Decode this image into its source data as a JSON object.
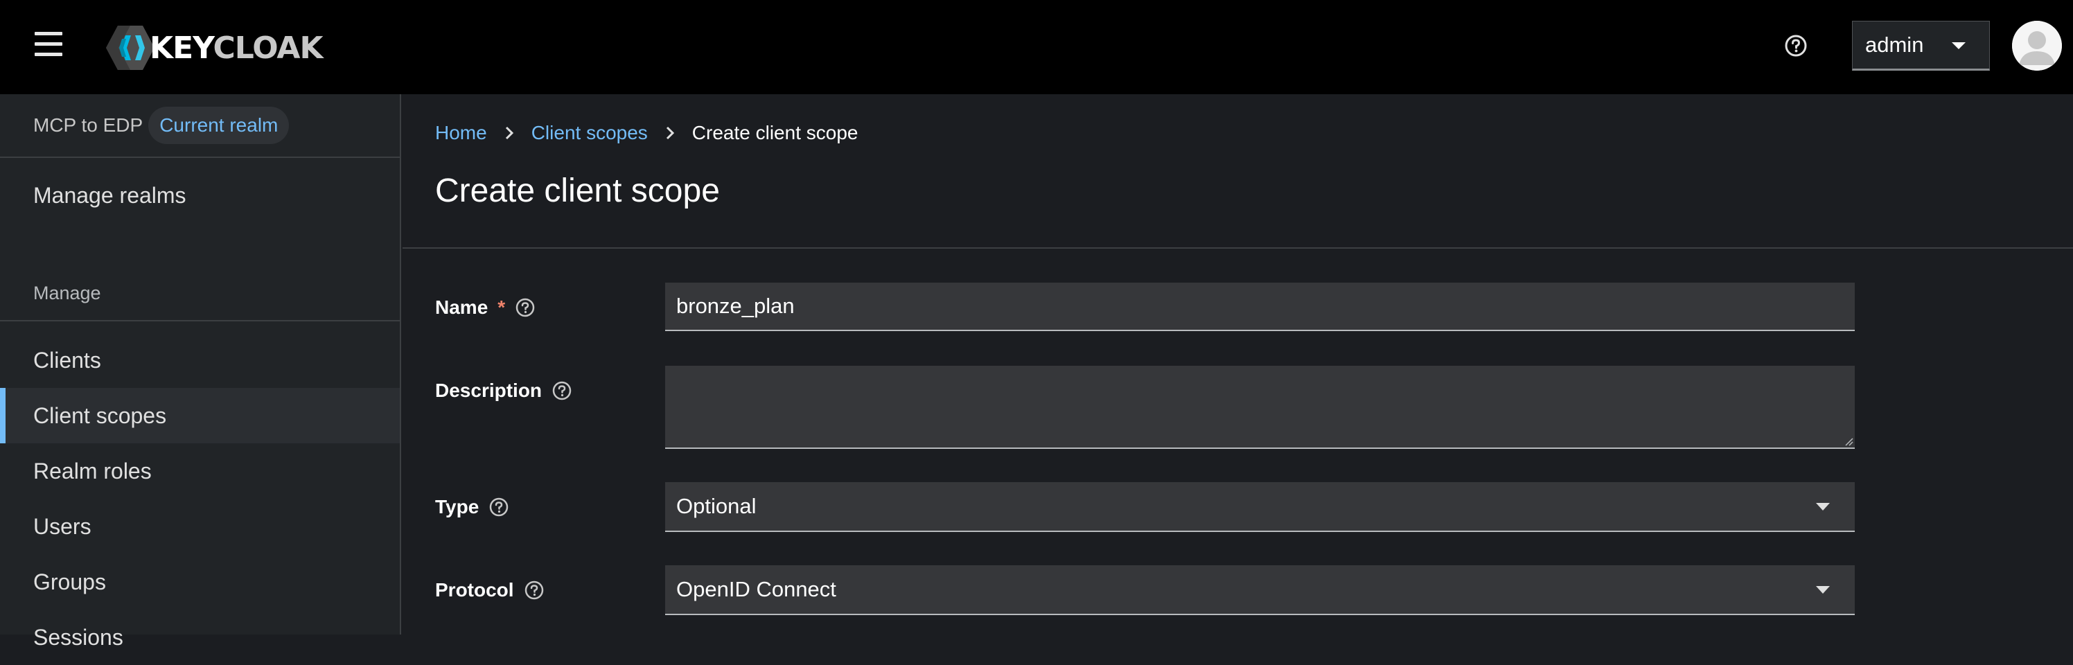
{
  "header": {
    "logo_text_key": "KEY",
    "logo_text_cloak": "CLOAK",
    "user_label": "admin",
    "icons": [
      "hamburger-icon",
      "help-icon",
      "caret-down-icon",
      "avatar-icon"
    ]
  },
  "sidebar": {
    "realm_name": "MCP to EDP",
    "realm_badge": "Current realm",
    "manage_realms": "Manage realms",
    "section_title": "Manage",
    "items": [
      {
        "label": "Clients",
        "active": false
      },
      {
        "label": "Client scopes",
        "active": true
      },
      {
        "label": "Realm roles",
        "active": false
      },
      {
        "label": "Users",
        "active": false
      },
      {
        "label": "Groups",
        "active": false
      },
      {
        "label": "Sessions",
        "active": false
      }
    ]
  },
  "main": {
    "breadcrumb": {
      "home": "Home",
      "client_scopes": "Client scopes",
      "current": "Create client scope"
    },
    "title": "Create client scope",
    "form": {
      "name": {
        "label": "Name",
        "required": "*",
        "value": "bronze_plan"
      },
      "description": {
        "label": "Description",
        "value": ""
      },
      "type": {
        "label": "Type",
        "value": "Optional"
      },
      "protocol": {
        "label": "Protocol",
        "value": "OpenID Connect"
      }
    }
  },
  "colors": {
    "accent": "#73bcf7",
    "background": "#1b1d21",
    "sidebar": "#212427",
    "masthead": "#000000",
    "input": "#36373a",
    "required": "#f0836b"
  }
}
